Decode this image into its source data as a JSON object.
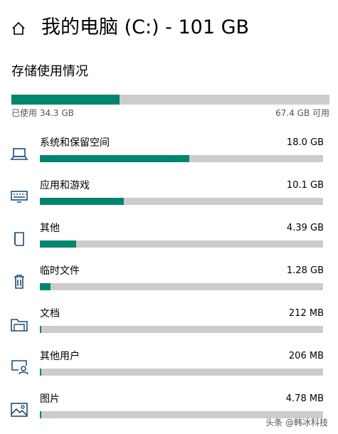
{
  "header": {
    "title": "我的电脑 (C:) - 101 GB",
    "home_icon": "home-icon"
  },
  "storage": {
    "section_title": "存储使用情况",
    "used_label": "已使用 34.3 GB",
    "free_label": "67.4 GB 可用",
    "used_fraction": 0.34
  },
  "categories": [
    {
      "label": "系统和保留空间",
      "size": "18.0 GB",
      "icon": "laptop-icon",
      "fraction": 0.528
    },
    {
      "label": "应用和游戏",
      "size": "10.1 GB",
      "icon": "keyboard-icon",
      "fraction": 0.296
    },
    {
      "label": "其他",
      "size": "4.39 GB",
      "icon": "book-icon",
      "fraction": 0.128
    },
    {
      "label": "临时文件",
      "size": "1.28 GB",
      "icon": "trash-icon",
      "fraction": 0.037
    },
    {
      "label": "文档",
      "size": "212 MB",
      "icon": "folder-icon",
      "fraction": 0.006
    },
    {
      "label": "其他用户",
      "size": "206 MB",
      "icon": "user-monitor-icon",
      "fraction": 0.006
    },
    {
      "label": "图片",
      "size": "4.78 MB",
      "icon": "picture-icon",
      "fraction": 0.001
    }
  ],
  "watermark": "头条 @韩冰科技",
  "colors": {
    "accent": "#00866d",
    "track": "#cccccc",
    "icon": "#1f4d78"
  }
}
